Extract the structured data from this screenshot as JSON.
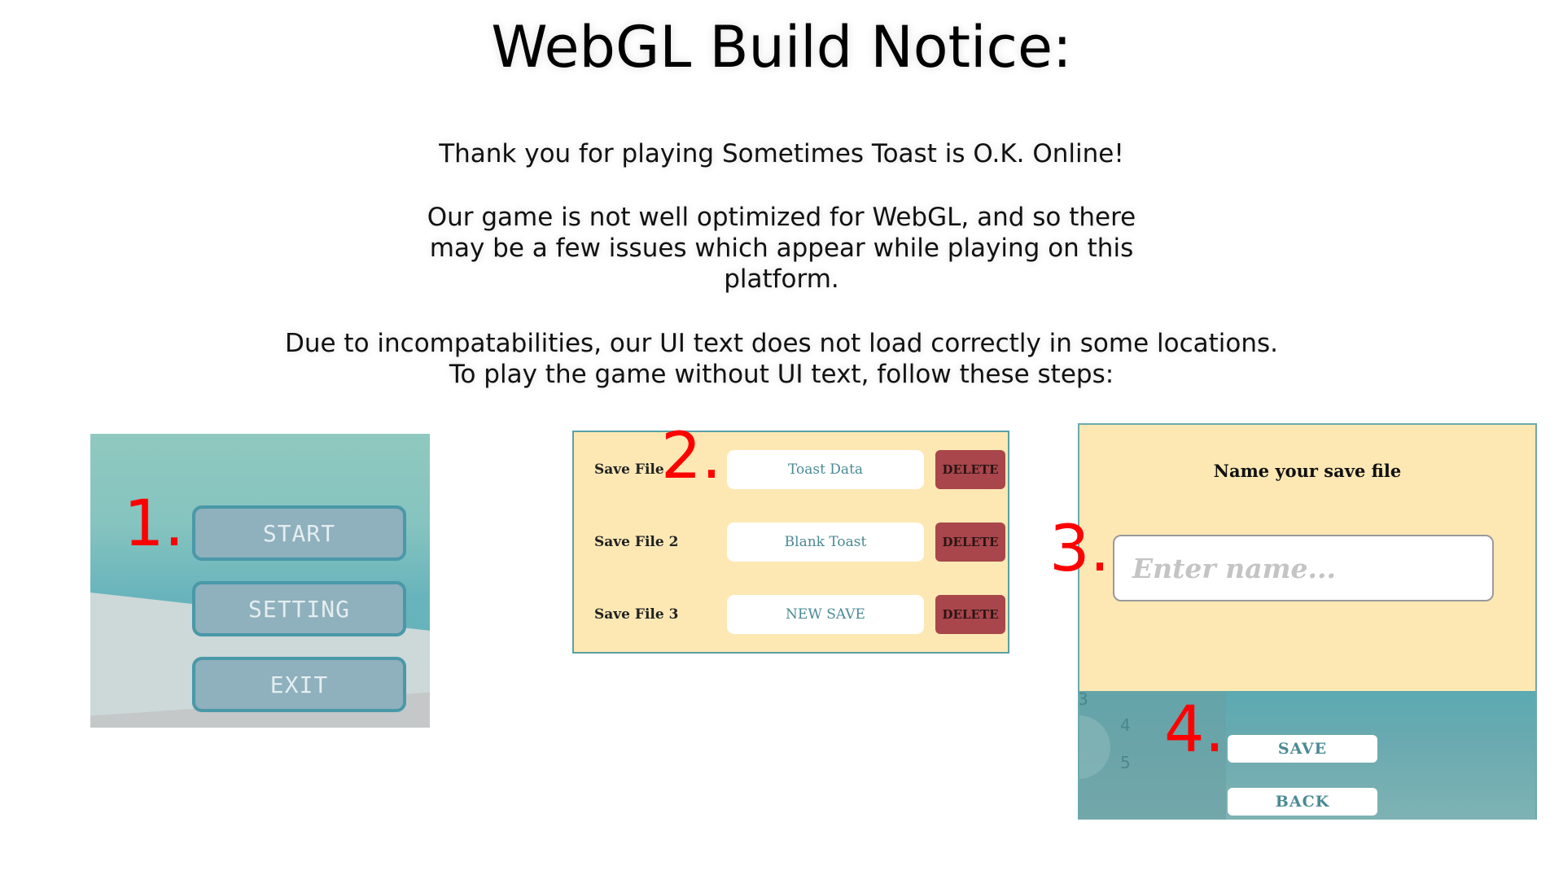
{
  "notice": {
    "title": "WebGL Build Notice:",
    "thanks": "Thank you for playing Sometimes Toast is O.K. Online!",
    "optimization_lines": [
      "Our game is not well optimized for WebGL, and so there",
      "may be a few issues which appear while playing on this",
      "platform."
    ],
    "incompat_lines": [
      "Due to incompatabilities, our UI text does not load correctly in some locations.",
      "To play the game without UI text, follow these steps:"
    ]
  },
  "steps": [
    "1.",
    "2.",
    "3.",
    "4."
  ],
  "menu": {
    "start": "START",
    "setting": "SETTING",
    "exit": "EXIT"
  },
  "saves": {
    "rows": [
      {
        "label": "Save File",
        "name": "Toast Data",
        "delete": "DELETE"
      },
      {
        "label": "Save File 2",
        "name": "Blank Toast",
        "delete": "DELETE"
      },
      {
        "label": "Save File 3",
        "name": "NEW SAVE",
        "delete": "DELETE"
      }
    ]
  },
  "name_dialog": {
    "prompt": "Name your save file",
    "input_placeholder": "Enter name...",
    "save": "SAVE",
    "back": "BACK",
    "bg_digits": [
      "3",
      "4",
      "5"
    ]
  },
  "colors": {
    "step_number": "#ff0000",
    "panel_cream": "#fde8b4",
    "teal": "#5aa0a6",
    "delete_red": "#a8464b"
  }
}
